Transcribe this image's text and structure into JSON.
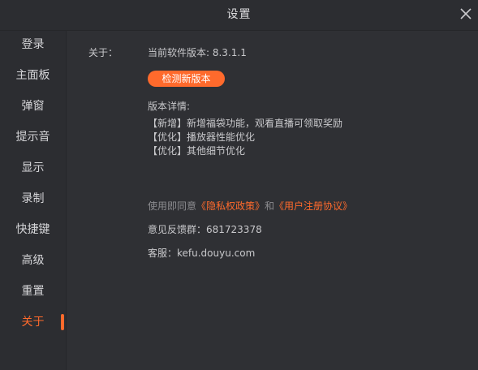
{
  "window": {
    "title": "设置"
  },
  "sidebar": {
    "items": [
      {
        "label": "登录"
      },
      {
        "label": "主面板"
      },
      {
        "label": "弹窗"
      },
      {
        "label": "提示音"
      },
      {
        "label": "显示"
      },
      {
        "label": "录制"
      },
      {
        "label": "快捷键"
      },
      {
        "label": "高级"
      },
      {
        "label": "重置"
      },
      {
        "label": "关于"
      }
    ],
    "active_index": 9
  },
  "about": {
    "section_label": "关于：",
    "version_text": "当前软件版本: 8.3.1.1",
    "check_button": "检测新版本",
    "details_title": "版本详情:",
    "details": [
      "【新增】新增福袋功能，观看直播可领取奖励",
      "【优化】播放器性能优化",
      "【优化】其他细节优化"
    ],
    "agreement_prefix": "使用即同意",
    "privacy_link": "《隐私权政策》",
    "agreement_and": "和",
    "user_agreement_link": "《用户注册协议》",
    "feedback_group": "意见反馈群：681723378",
    "service": "客服：kefu.douyu.com"
  },
  "colors": {
    "accent": "#ff6a2c",
    "background": "#2f3034",
    "sidebar": "#2c2d31"
  },
  "icons": {
    "close": "close-icon"
  }
}
